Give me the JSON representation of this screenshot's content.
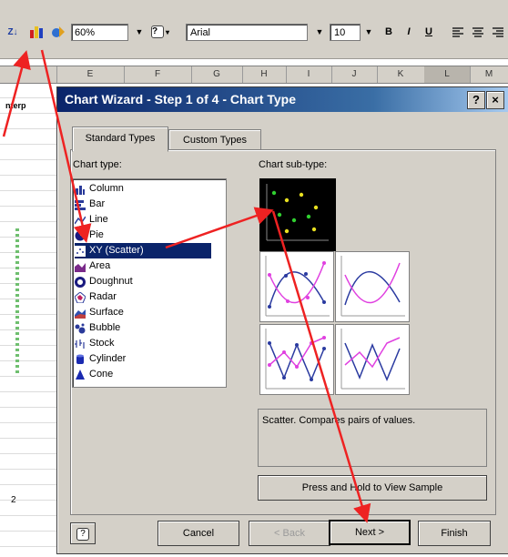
{
  "toolbar": {
    "sort_label": "Z↓",
    "zoom": "60%",
    "help_label": "?",
    "font": "Arial",
    "font_size": "10",
    "bold": "B",
    "italic": "I",
    "underline": "U"
  },
  "columns": [
    "E",
    "F",
    "G",
    "H",
    "I",
    "J",
    "K",
    "L",
    "M"
  ],
  "sheet": {
    "cell_fragment": "nterp",
    "row_number": "2"
  },
  "dialog": {
    "title": "Chart Wizard - Step 1 of 4 - Chart Type",
    "help_btn": "?",
    "close_btn": "×",
    "tabs": [
      "Standard Types",
      "Custom Types"
    ],
    "chart_type_label": "Chart type:",
    "chart_subtype_label": "Chart sub-type:",
    "chart_types": [
      "Column",
      "Bar",
      "Line",
      "Pie",
      "XY (Scatter)",
      "Area",
      "Doughnut",
      "Radar",
      "Surface",
      "Bubble",
      "Stock",
      "Cylinder",
      "Cone"
    ],
    "selected_type": "XY (Scatter)",
    "description": "Scatter. Compares pairs of values.",
    "sample_button": "Press and Hold to View Sample",
    "buttons": {
      "help": "?",
      "cancel": "Cancel",
      "back": "< Back",
      "next": "Next >",
      "finish": "Finish"
    }
  },
  "colors": {
    "title_bar": "#0a246a",
    "selection": "#0a246a",
    "annotation_arrow": "#ee2222"
  }
}
